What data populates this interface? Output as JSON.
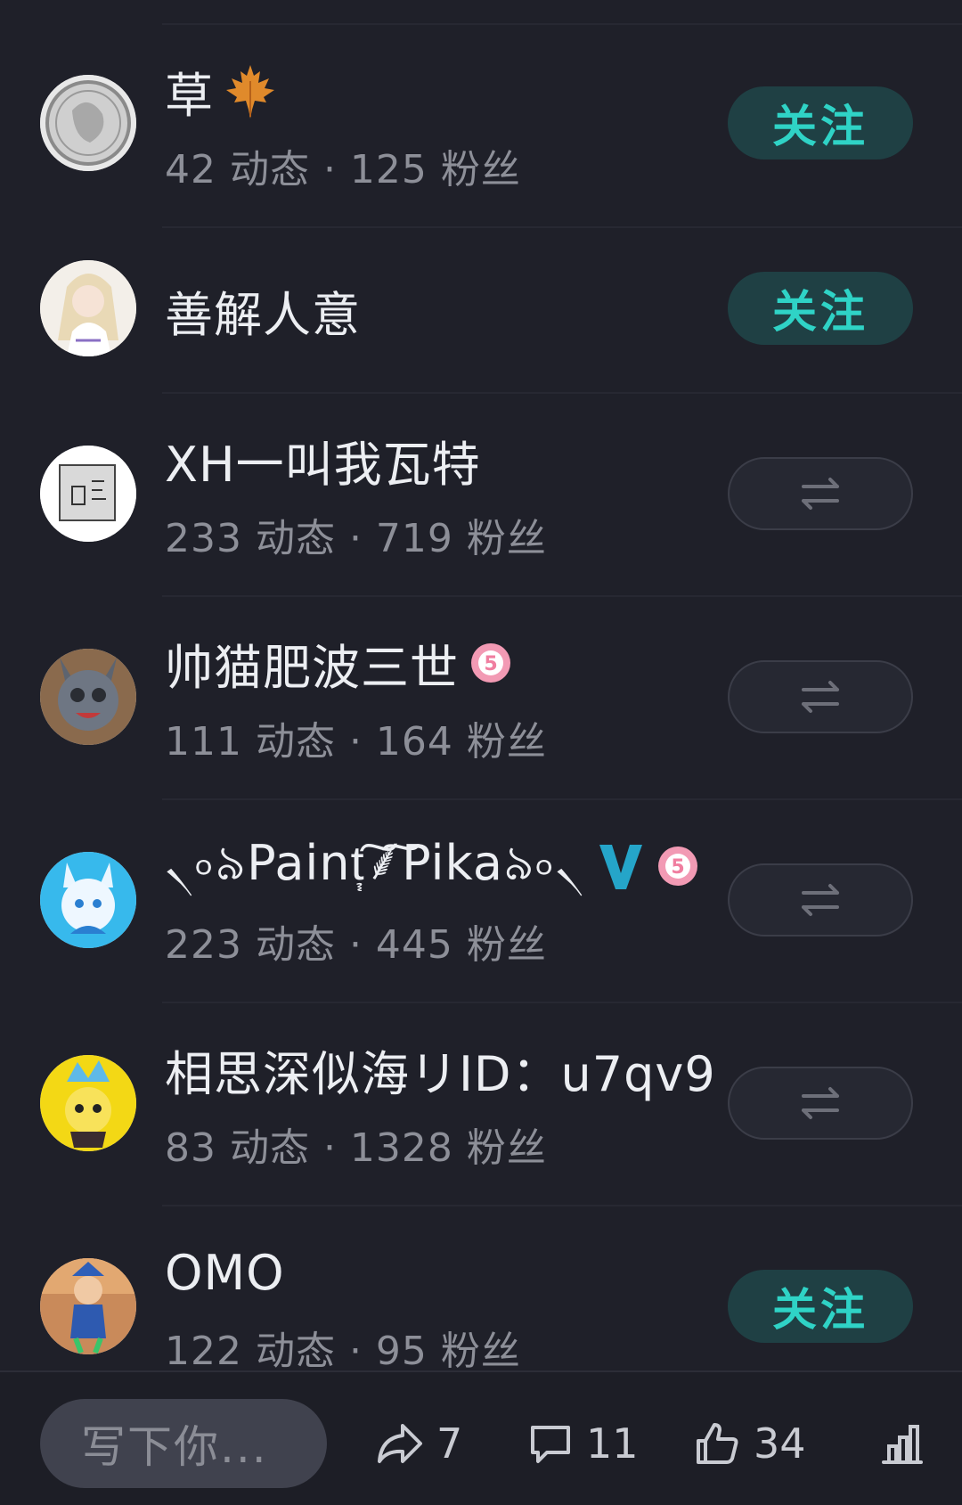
{
  "users": [
    {
      "name": "草",
      "stats": "42 动态 · 125 粉丝",
      "button": "follow",
      "badge": "maple-leaf-icon"
    },
    {
      "name": "善解人意",
      "stats": "",
      "button": "follow",
      "badge": ""
    },
    {
      "name": "XH一叫我瓦特",
      "stats": "233 动态 · 719 粉丝",
      "button": "mutual",
      "badge": ""
    },
    {
      "name": "帅猫肥波三世",
      "stats": "111 动态 · 164 粉丝",
      "button": "mutual",
      "badge": "level-5"
    },
    {
      "name": "৲৹৯Paint᷂͠⸙͠Pika৯৹৲",
      "stats": "223 动态 · 445 粉丝",
      "button": "mutual",
      "badge": "verified-v-and-level-5"
    },
    {
      "name": "相思深似海リID：u7qv9",
      "stats": "83 动态 · 1328 粉丝",
      "button": "mutual",
      "badge": ""
    },
    {
      "name": "OMO",
      "stats": "122 动态 · 95 粉丝",
      "button": "follow",
      "badge": ""
    }
  ],
  "follow_label": "关注",
  "colors": {
    "background": "#1f2029",
    "accent": "#2fd3c6",
    "follow_bg": "#1f4044",
    "level_badge": "#f29ab4",
    "verified": "#25a5c9"
  },
  "bottom_bar": {
    "comment_placeholder": "写下你...",
    "share_count": "7",
    "comment_count": "11",
    "like_count": "34"
  }
}
